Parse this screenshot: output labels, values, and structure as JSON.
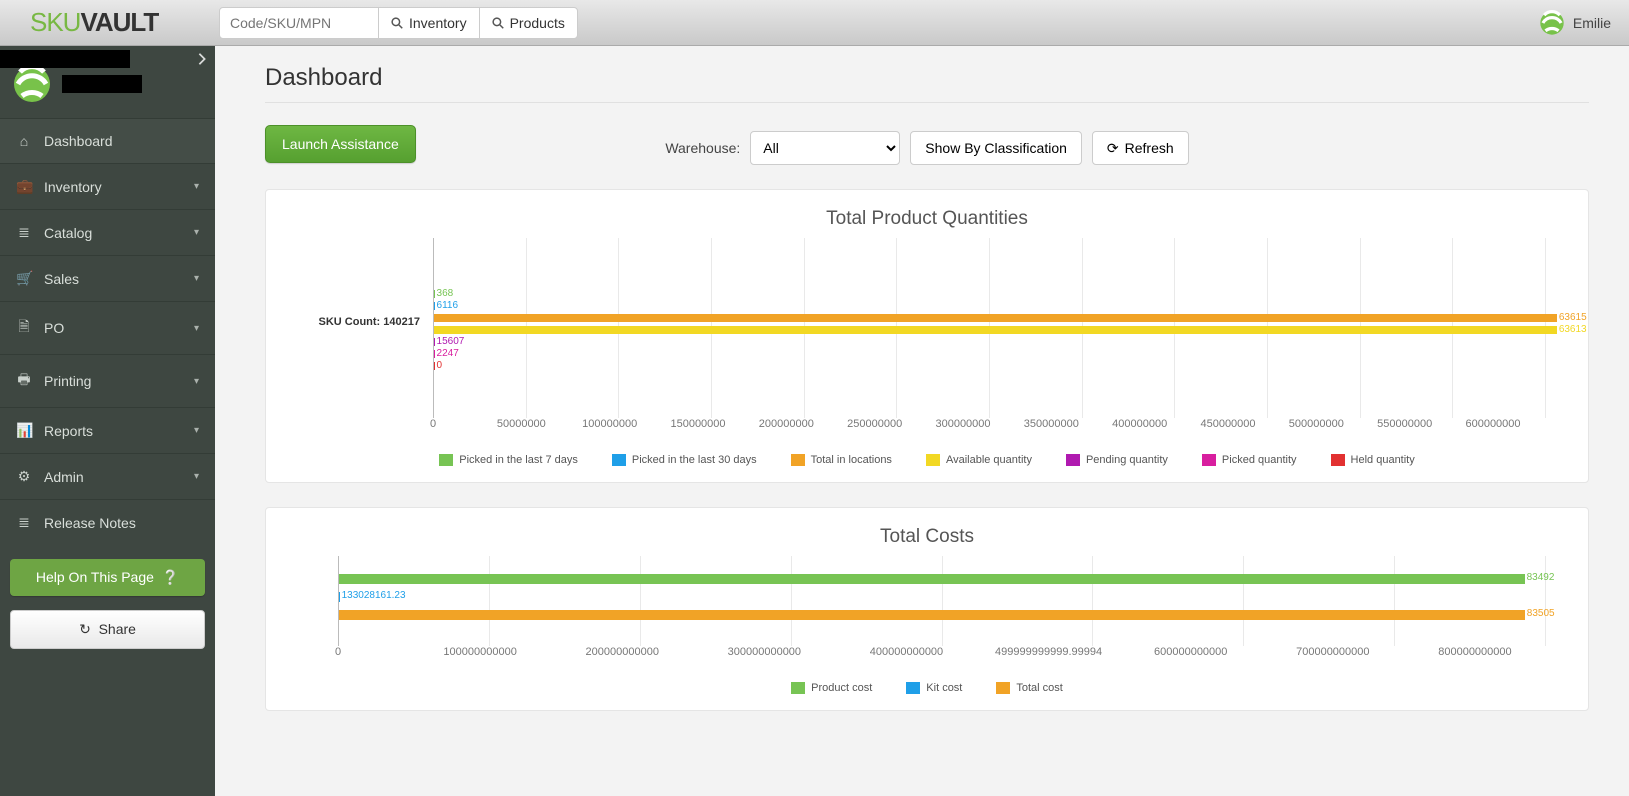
{
  "brand": {
    "left": "SKU",
    "right": "VAULT"
  },
  "topbar": {
    "search_placeholder": "Code/SKU/MPN",
    "inventory_label": "Inventory",
    "products_label": "Products"
  },
  "user": {
    "name": "Emilie"
  },
  "sidebar": {
    "items": [
      {
        "icon": "home",
        "label": "Dashboard",
        "expandable": false,
        "active": true
      },
      {
        "icon": "case",
        "label": "Inventory",
        "expandable": true
      },
      {
        "icon": "list",
        "label": "Catalog",
        "expandable": true
      },
      {
        "icon": "cart",
        "label": "Sales",
        "expandable": true
      },
      {
        "icon": "doc",
        "label": "PO",
        "expandable": true
      },
      {
        "icon": "print",
        "label": "Printing",
        "expandable": true
      },
      {
        "icon": "chart",
        "label": "Reports",
        "expandable": true
      },
      {
        "icon": "gears",
        "label": "Admin",
        "expandable": true
      },
      {
        "icon": "list",
        "label": "Release Notes",
        "expandable": false
      }
    ],
    "help_label": "Help On This Page",
    "share_label": "Share"
  },
  "page": {
    "title": "Dashboard"
  },
  "actions": {
    "launch_label": "Launch Assistance",
    "warehouse_label": "Warehouse:",
    "warehouse_value": "All",
    "classify_label": "Show By Classification",
    "refresh_label": "Refresh"
  },
  "colors": {
    "green": "#77c454",
    "blue": "#1f9fe8",
    "orange": "#f1a326",
    "yellow": "#f2d823",
    "purple": "#b01ab0",
    "magenta": "#d81f9f",
    "red": "#e23131"
  },
  "chart_data": [
    {
      "type": "bar",
      "orientation": "horizontal",
      "title": "Total Product Quantities",
      "ylabel": "SKU Count: 140217",
      "xlim": [
        0,
        630000000
      ],
      "x_ticks": [
        0,
        50000000,
        100000000,
        150000000,
        200000000,
        250000000,
        300000000,
        350000000,
        400000000,
        450000000,
        500000000,
        550000000,
        600000000
      ],
      "series": [
        {
          "name": "Picked in the last 7 days",
          "color": "green",
          "value": 368
        },
        {
          "name": "Picked in the last 30 days",
          "color": "blue",
          "value": 6116
        },
        {
          "name": "Total in locations",
          "color": "orange",
          "value": 636150000
        },
        {
          "name": "Available quantity",
          "color": "yellow",
          "value": 636130000
        },
        {
          "name": "Pending quantity",
          "color": "purple",
          "value": 15607
        },
        {
          "name": "Picked quantity",
          "color": "magenta",
          "value": 2247
        },
        {
          "name": "Held quantity",
          "color": "red",
          "value": 0
        }
      ],
      "value_labels": [
        "368",
        "6116",
        "63615",
        "63613",
        "15607",
        "2247",
        "0"
      ]
    },
    {
      "type": "bar",
      "orientation": "horizontal",
      "title": "Total Costs",
      "xlim": [
        0,
        850000000000
      ],
      "x_ticks_raw": [
        0,
        100000000000,
        200000000000,
        300000000000,
        400000000000,
        499999999999.99994,
        600000000000,
        700000000000,
        800000000000
      ],
      "x_tick_labels": [
        "0",
        "100000000000",
        "200000000000",
        "300000000000",
        "400000000000",
        "499999999999.99994",
        "600000000000",
        "700000000000",
        "800000000000"
      ],
      "series": [
        {
          "name": "Product cost",
          "color": "green",
          "value": 834920000000
        },
        {
          "name": "Kit cost",
          "color": "blue",
          "value": 133028161.23
        },
        {
          "name": "Total cost",
          "color": "orange",
          "value": 835050000000
        }
      ],
      "value_labels": [
        "83492",
        "133028161.23",
        "83505"
      ]
    }
  ]
}
